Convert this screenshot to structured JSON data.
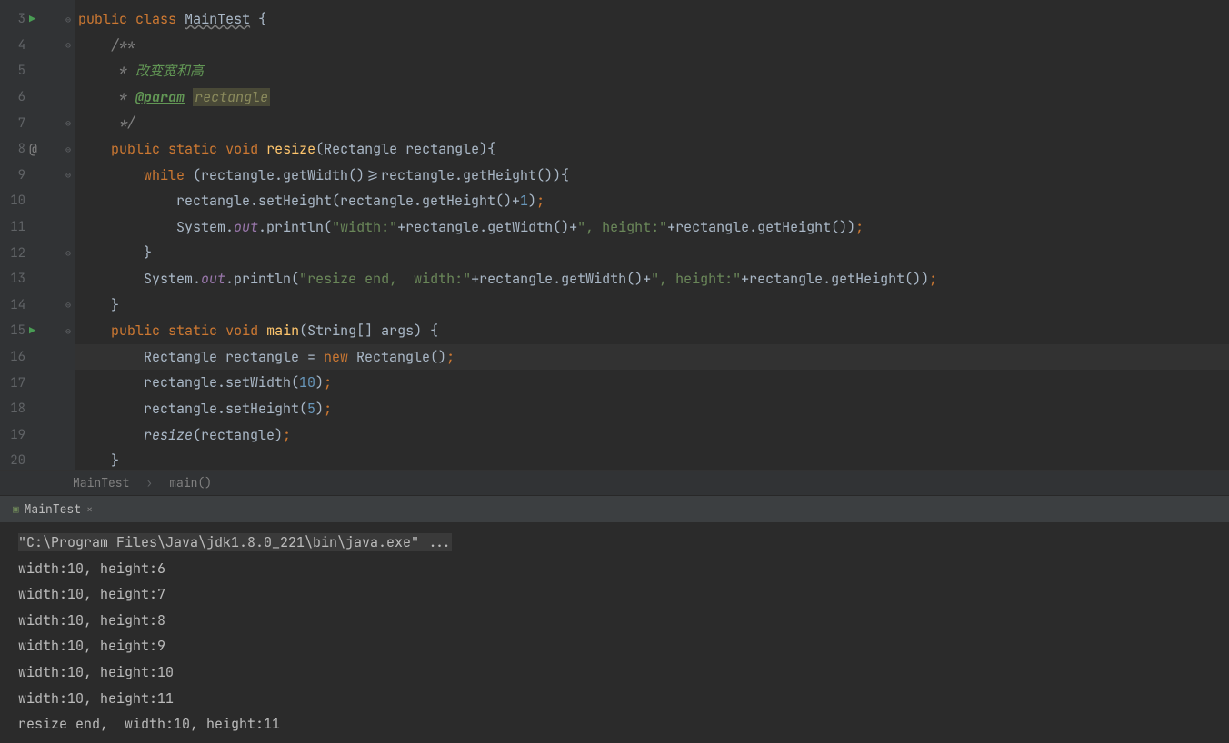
{
  "gutter": {
    "lines": [
      3,
      4,
      5,
      6,
      7,
      8,
      9,
      10,
      11,
      12,
      13,
      14,
      15,
      16,
      17,
      18,
      19,
      20
    ]
  },
  "code": {
    "l3": {
      "kw1": "public",
      "kw2": "class",
      "cls": "MainTest",
      "brace": " {"
    },
    "l4": {
      "txt": "/**"
    },
    "l5": {
      "star": " * ",
      "txt": "改变宽和高"
    },
    "l6": {
      "star": " * ",
      "tag": "@param",
      "sp": " ",
      "param": "rectangle"
    },
    "l7": {
      "txt": " */"
    },
    "l8": {
      "kw1": "public",
      "kw2": "static",
      "kw3": "void",
      "m": "resize",
      "params": "(Rectangle rectangle)",
      "brace": "{"
    },
    "l9": {
      "kw": "while",
      "cond": " (rectangle.getWidth()>=rectangle.getHeight())",
      "brace": "{"
    },
    "l10": {
      "a": "rectangle.setHeight(rectangle.getHeight()+",
      "n": "1",
      "b": ")",
      "p": ";"
    },
    "l11": {
      "a": "System.",
      "f": "out",
      "b": ".println(",
      "s1": "\"width:\"",
      "c": "+rectangle.getWidth()+",
      "s2": "\", height:\"",
      "d": "+rectangle.getHeight())",
      "p": ";"
    },
    "l12": {
      "txt": "}"
    },
    "l13": {
      "a": "System.",
      "f": "out",
      "b": ".println(",
      "s1": "\"resize end,  width:\"",
      "c": "+rectangle.getWidth()+",
      "s2": "\", height:\"",
      "d": "+rectangle.getHeight())",
      "p": ";"
    },
    "l14": {
      "txt": "}"
    },
    "l15": {
      "kw1": "public",
      "kw2": "static",
      "kw3": "void",
      "m": "main",
      "params": "(String[] args) ",
      "brace": "{"
    },
    "l16": {
      "a": "Rectangle rectangle = ",
      "kw": "new",
      "b": " Rectangle()",
      "p": ";"
    },
    "l17": {
      "a": "rectangle.setWidth(",
      "n": "10",
      "b": ")",
      "p": ";"
    },
    "l18": {
      "a": "rectangle.setHeight(",
      "n": "5",
      "b": ")",
      "p": ";"
    },
    "l19": {
      "m": "resize",
      "a": "(rectangle)",
      "p": ";"
    },
    "l20": {
      "txt": "}"
    }
  },
  "breadcrumb": {
    "cls": "MainTest",
    "sep": "›",
    "method": "main()"
  },
  "tab": {
    "name": "MainTest",
    "close": "×"
  },
  "console": {
    "cmd": "\"C:\\Program Files\\Java\\jdk1.8.0_221\\bin\\java.exe\" ...",
    "l1": "width:10, height:6",
    "l2": "width:10, height:7",
    "l3": "width:10, height:8",
    "l4": "width:10, height:9",
    "l5": "width:10, height:10",
    "l6": "width:10, height:11",
    "l7": "resize end,  width:10, height:11"
  }
}
